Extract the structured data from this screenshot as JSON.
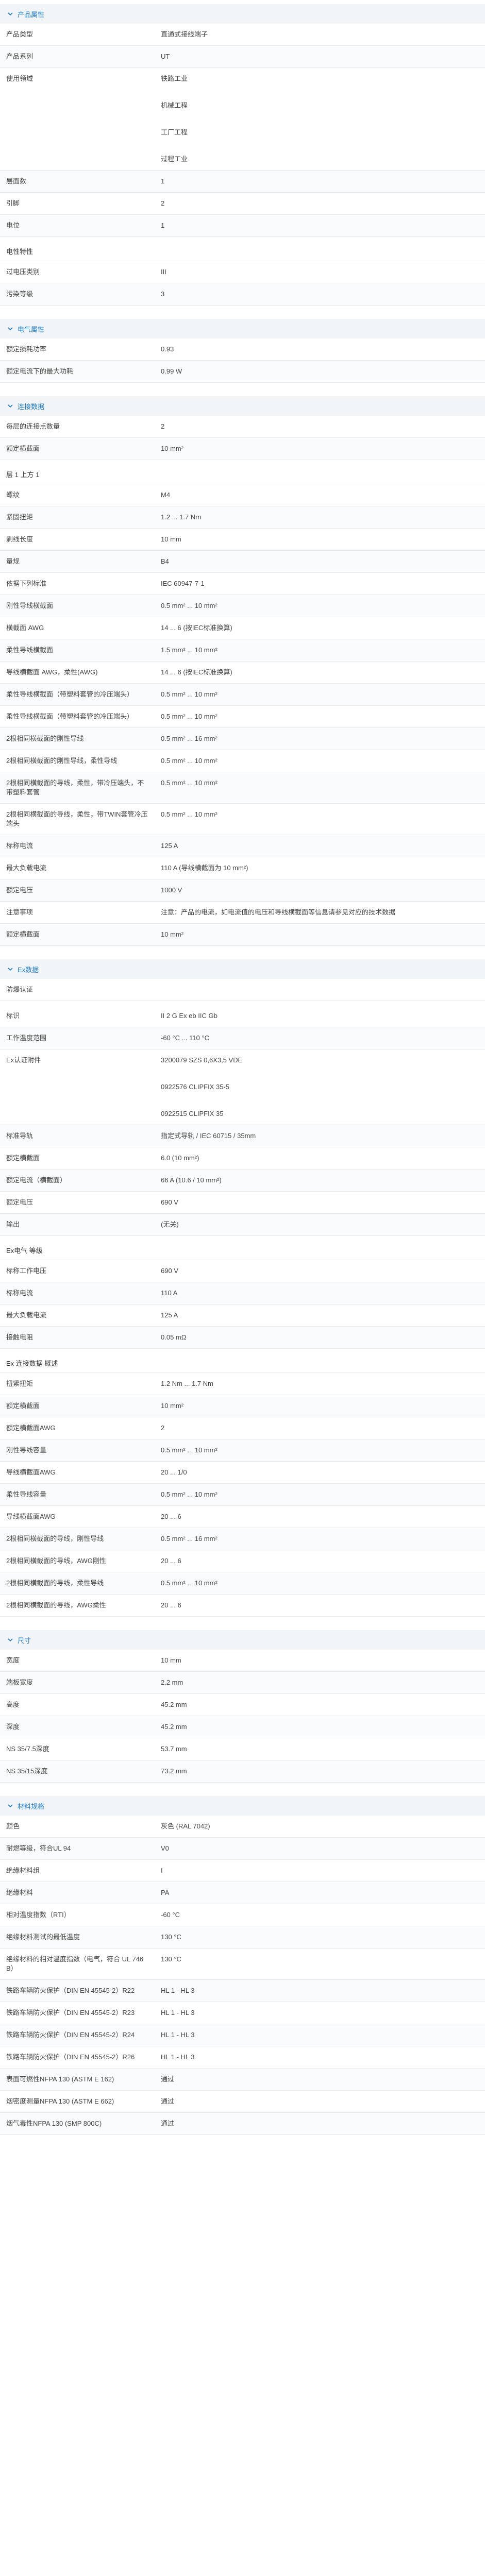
{
  "sections": [
    {
      "id": "product",
      "title": "产品属性",
      "rows": [
        {
          "k": "产品类型",
          "v": [
            "直通式接线端子"
          ]
        },
        {
          "k": "产品系列",
          "v": [
            "UT"
          ]
        },
        {
          "k": "使用领域",
          "v": [
            "铁路工业",
            "机械工程",
            "工厂工程",
            "过程工业"
          ]
        },
        {
          "k": "层面数",
          "v": [
            "1"
          ]
        },
        {
          "k": "引脚",
          "v": [
            "2"
          ]
        },
        {
          "k": "电位",
          "v": [
            "1"
          ]
        }
      ],
      "subsections": [
        {
          "title": "电性特性",
          "rows": [
            {
              "k": "过电压类别",
              "v": [
                "III"
              ]
            },
            {
              "k": "污染等级",
              "v": [
                "3"
              ]
            }
          ]
        }
      ]
    },
    {
      "id": "electrical",
      "title": "电气属性",
      "rows": [
        {
          "k": "额定损耗功率",
          "v": [
            "0.93"
          ]
        },
        {
          "k": "额定电流下的最大功耗",
          "v": [
            "0.99 W"
          ]
        }
      ]
    },
    {
      "id": "connection",
      "title": "连接数据",
      "rows": [
        {
          "k": "每层的连接点数量",
          "v": [
            "2"
          ]
        },
        {
          "k": "额定横截面",
          "v": [
            "10 mm²"
          ]
        }
      ],
      "subsections": [
        {
          "title": "层 1 上方 1",
          "rows": [
            {
              "k": "螺纹",
              "v": [
                "M4"
              ]
            },
            {
              "k": "紧固扭矩",
              "v": [
                "1.2 ... 1.7 Nm"
              ]
            },
            {
              "k": "剥线长度",
              "v": [
                "10 mm"
              ]
            },
            {
              "k": "量规",
              "v": [
                "B4"
              ]
            },
            {
              "k": "依据下列标准",
              "v": [
                "IEC 60947-7-1"
              ]
            },
            {
              "k": "刚性导线横截面",
              "v": [
                "0.5 mm² ... 10 mm²"
              ]
            },
            {
              "k": "横截面 AWG",
              "v": [
                "14 ... 6 (按IEC标准换算)"
              ]
            },
            {
              "k": "柔性导线横截面",
              "v": [
                "1.5 mm² ... 10 mm²"
              ]
            },
            {
              "k": "导线横截面 AWG，柔性(AWG)",
              "v": [
                "14 ... 6 (按IEC标准换算)"
              ]
            },
            {
              "k": "柔性导线横截面（带塑料套管的冷压端头）",
              "v": [
                "0.5 mm² ... 10 mm²"
              ]
            },
            {
              "k": "柔性导线横截面（带塑料套管的冷压端头）",
              "v": [
                "0.5 mm² ... 10 mm²"
              ]
            },
            {
              "k": "2根相同横截面的刚性导线",
              "v": [
                "0.5 mm² ... 16 mm²"
              ]
            },
            {
              "k": "2根相同横截面的刚性导线，柔性导线",
              "v": [
                "0.5 mm² ... 10 mm²"
              ]
            },
            {
              "k": "2根相同横截面的导线，柔性，带冷压端头，不带塑料套管",
              "v": [
                "0.5 mm² ... 10 mm²"
              ]
            },
            {
              "k": "2根相同横截面的导线，柔性，带TWIN套管冷压端头",
              "v": [
                "0.5 mm² ... 10 mm²"
              ]
            },
            {
              "k": "标称电流",
              "v": [
                "125 A"
              ]
            },
            {
              "k": "最大负载电流",
              "v": [
                "110 A (导线横截面为 10 mm²)"
              ]
            },
            {
              "k": "额定电压",
              "v": [
                "1000 V"
              ]
            },
            {
              "k": "注意事项",
              "v": [
                "注意：产品的电流，如电流值的电压和导线横截面等信息请参见对应的技术数据"
              ]
            },
            {
              "k": "额定横截面",
              "v": [
                "10 mm²"
              ]
            }
          ]
        }
      ]
    },
    {
      "id": "ex",
      "title": "Ex数据",
      "rows": [
        {
          "k": "防爆认证",
          "v": []
        }
      ],
      "subsections": [
        {
          "title": "",
          "rows": [
            {
              "k": "标识",
              "v": [
                "II 2 G Ex eb IIC Gb"
              ]
            },
            {
              "k": "工作温度范围",
              "v": [
                "-60 °C ... 110 °C"
              ]
            },
            {
              "k": "Ex认证附件",
              "v": [
                "3200079 SZS 0,6X3,5 VDE",
                "0922576 CLIPFIX 35-5",
                "0922515 CLIPFIX 35"
              ]
            },
            {
              "k": "标准导轨",
              "v": [
                "指定式导轨 / IEC 60715 / 35mm"
              ]
            },
            {
              "k": "额定横截面",
              "v": [
                "6.0 (10 mm²)"
              ]
            },
            {
              "k": "额定电流（横截面）",
              "v": [
                "66 A (10.6 / 10 mm²)"
              ]
            },
            {
              "k": "额定电压",
              "v": [
                "690 V"
              ]
            },
            {
              "k": "输出",
              "v": [
                "(无关)"
              ]
            }
          ]
        },
        {
          "title": "Ex电气 等级",
          "rows": [
            {
              "k": "标称工作电压",
              "v": [
                "690 V"
              ]
            },
            {
              "k": "标称电流",
              "v": [
                "110 A"
              ]
            },
            {
              "k": "最大负载电流",
              "v": [
                "125 A"
              ]
            },
            {
              "k": "接触电阻",
              "v": [
                "0.05 mΩ"
              ]
            }
          ]
        },
        {
          "title": "Ex 连接数据 概述",
          "rows": [
            {
              "k": "扭紧扭矩",
              "v": [
                "1.2 Nm ... 1.7 Nm"
              ]
            },
            {
              "k": "额定横截面",
              "v": [
                "10 mm²"
              ]
            },
            {
              "k": "额定横截面AWG",
              "v": [
                "2"
              ]
            },
            {
              "k": "刚性导线容量",
              "v": [
                "0.5 mm² ... 10 mm²"
              ]
            },
            {
              "k": "导线横截面AWG",
              "v": [
                "20 ... 1/0"
              ]
            },
            {
              "k": "柔性导线容量",
              "v": [
                "0.5 mm² ... 10 mm²"
              ]
            },
            {
              "k": "导线横截面AWG",
              "v": [
                "20 ... 6"
              ]
            },
            {
              "k": "2根相同横截面的导线，刚性导线",
              "v": [
                "0.5 mm² ... 16 mm²"
              ]
            },
            {
              "k": "2根相同横截面的导线，AWG刚性",
              "v": [
                "20 ... 6"
              ]
            },
            {
              "k": "2根相同横截面的导线，柔性导线",
              "v": [
                "0.5 mm² ... 10 mm²"
              ]
            },
            {
              "k": "2根相同横截面的导线，AWG柔性",
              "v": [
                "20 ... 6"
              ]
            }
          ]
        }
      ]
    },
    {
      "id": "dims",
      "title": "尺寸",
      "rows": [
        {
          "k": "宽度",
          "v": [
            "10 mm"
          ]
        },
        {
          "k": "端板宽度",
          "v": [
            "2.2 mm"
          ]
        },
        {
          "k": "高度",
          "v": [
            "45.2 mm"
          ]
        },
        {
          "k": "深度",
          "v": [
            "45.2 mm"
          ]
        },
        {
          "k": "NS 35/7.5深度",
          "v": [
            "53.7 mm"
          ]
        },
        {
          "k": "NS 35/15深度",
          "v": [
            "73.2 mm"
          ]
        }
      ]
    },
    {
      "id": "material",
      "title": "材料规格",
      "rows": [
        {
          "k": "颜色",
          "v": [
            "灰色 (RAL 7042)"
          ]
        },
        {
          "k": "耐燃等级，符合UL 94",
          "v": [
            "V0"
          ]
        },
        {
          "k": "绝缘材料组",
          "v": [
            "I"
          ]
        },
        {
          "k": "绝缘材料",
          "v": [
            "PA"
          ]
        },
        {
          "k": "相对温度指数（RTI）",
          "v": [
            "-60 °C"
          ]
        },
        {
          "k": "绝缘材料测试的最低温度",
          "v": [
            "130 °C"
          ]
        },
        {
          "k": "绝缘材料的相对温度指数（电气，符合 UL 746 B）",
          "v": [
            "130 °C"
          ]
        },
        {
          "k": "铁路车辆防火保护（DIN EN 45545-2）R22",
          "v": [
            "HL 1 - HL 3"
          ]
        },
        {
          "k": "铁路车辆防火保护（DIN EN 45545-2）R23",
          "v": [
            "HL 1 - HL 3"
          ]
        },
        {
          "k": "铁路车辆防火保护（DIN EN 45545-2）R24",
          "v": [
            "HL 1 - HL 3"
          ]
        },
        {
          "k": "铁路车辆防火保护（DIN EN 45545-2）R26",
          "v": [
            "HL 1 - HL 3"
          ]
        },
        {
          "k": "表面可燃性NFPA 130 (ASTM E 162)",
          "v": [
            "通过"
          ]
        },
        {
          "k": "烟密度测量NFPA 130 (ASTM E 662)",
          "v": [
            "通过"
          ]
        },
        {
          "k": "烟气毒性NFPA 130 (SMP 800C)",
          "v": [
            "通过"
          ]
        }
      ]
    }
  ]
}
